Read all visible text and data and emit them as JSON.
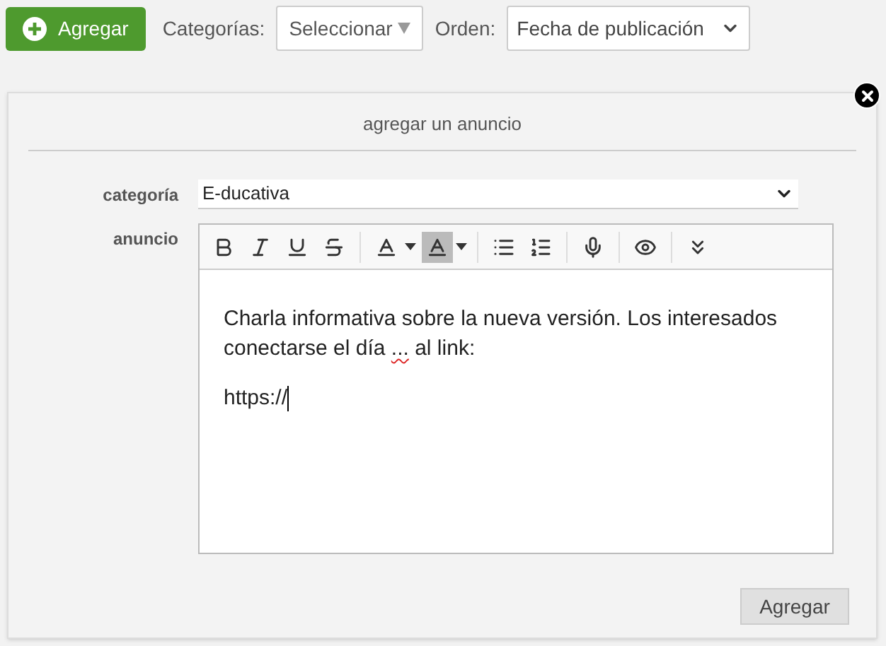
{
  "toolbar": {
    "add_button": "Agregar",
    "categories_label": "Categorías:",
    "categories_select": "Seleccionar",
    "order_label": "Orden:",
    "order_select": "Fecha de publicación"
  },
  "panel": {
    "title": "agregar un anuncio",
    "category": {
      "label": "categoría",
      "value": "E-ducativa"
    },
    "announcement": {
      "label": "anuncio",
      "paragraphs": [
        [
          {
            "text": "Charla informativa sobre la nueva versión. Los interesados conectarse el día ",
            "misspelled": false
          },
          {
            "text": "...",
            "misspelled": true
          },
          {
            "text": " al link:",
            "misspelled": false
          }
        ],
        [
          {
            "text": "https://",
            "misspelled": false
          }
        ]
      ]
    },
    "submit_button": "Agregar"
  }
}
